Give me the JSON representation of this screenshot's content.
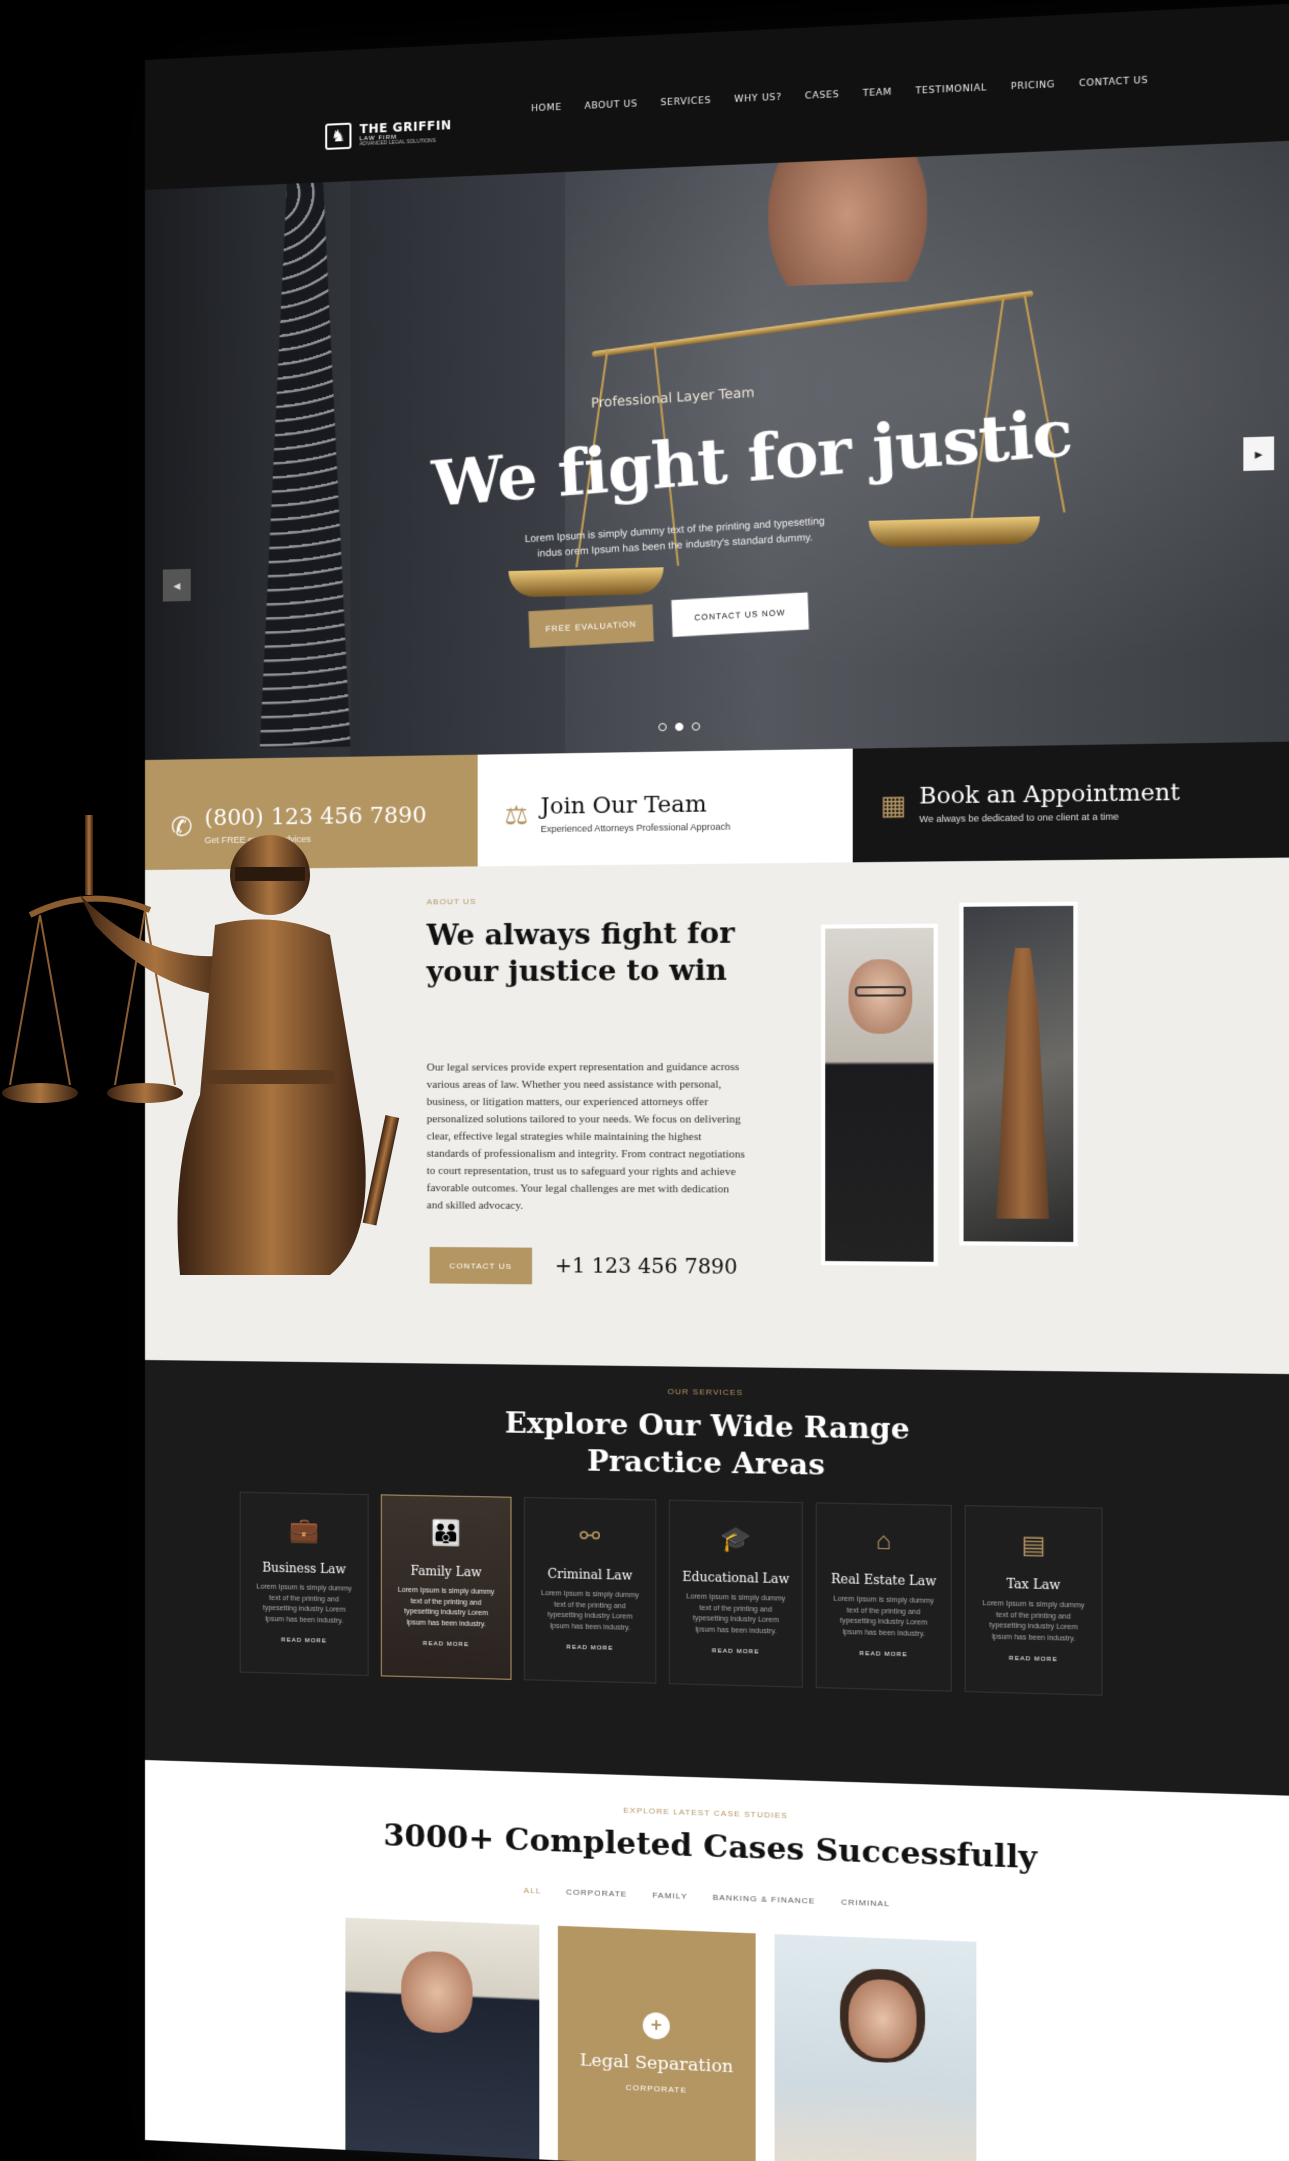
{
  "header": {
    "logo": {
      "name": "THE GRIFFIN",
      "sub": "LAW FIRM",
      "tag": "ADVANCED LEGAL SOLUTIONS"
    },
    "nav": [
      "HOME",
      "ABOUT US",
      "SERVICES",
      "WHY US?",
      "CASES",
      "TEAM",
      "TESTIMONIAL",
      "PRICING",
      "CONTACT US"
    ]
  },
  "hero": {
    "subtitle": "Professional Layer Team",
    "title": "We fight for justic",
    "text": "Lorem Ipsum is simply dummy text of the printing and typesetting indus orem Ipsum has been the industry's standard dummy.",
    "primary_button": "FREE EVALUATION",
    "secondary_button": "CONTACT US NOW",
    "prev_icon": "chevron-left-icon",
    "next_icon": "chevron-right-icon",
    "slide_count": 3,
    "active_slide": 1
  },
  "info_bar": {
    "phone": {
      "title": "(800) 123 456 7890",
      "sub": "Get FREE experts advices",
      "icon": "phone-icon"
    },
    "team": {
      "title": "Join Our Team",
      "sub": "Experienced Attorneys Professional Approach",
      "icon": "gavel-icon"
    },
    "appointment": {
      "title": "Book an Appointment",
      "sub": "We always be dedicated to one client at a time",
      "icon": "calendar-icon"
    }
  },
  "about": {
    "kicker": "ABOUT US",
    "title": "We always fight for your justice to win",
    "body": "Our legal services provide expert representation and guidance across various areas of law. Whether you need assistance with personal, business, or litigation matters, our experienced attorneys offer personalized solutions tailored to your needs. We focus on delivering clear, effective legal strategies while maintaining the highest standards of professionalism and integrity. From contract negotiations to court representation, trust us to safeguard your rights and achieve favorable outcomes. Your legal challenges are met with dedication and skilled advocacy.",
    "button": "CONTACT US",
    "phone": "+1 123 456 7890"
  },
  "services": {
    "kicker": "OUR SERVICES",
    "title_line1": "Explore Our Wide Range",
    "title_line2": "Practice Areas",
    "items": [
      {
        "name": "Business Law",
        "icon": "briefcase-icon",
        "desc": "Lorem Ipsum is simply dummy text of the printing and typesetting industry Lorem Ipsum has been industry.",
        "read": "READ MORE"
      },
      {
        "name": "Family Law",
        "icon": "family-icon",
        "desc": "Lorem Ipsum is simply dummy text of the printing and typesetting industry Lorem Ipsum has been industry.",
        "read": "READ MORE"
      },
      {
        "name": "Criminal Law",
        "icon": "handcuffs-icon",
        "desc": "Lorem Ipsum is simply dummy text of the printing and typesetting industry Lorem Ipsum has been industry.",
        "read": "READ MORE"
      },
      {
        "name": "Educational Law",
        "icon": "graduation-cap-icon",
        "desc": "Lorem Ipsum is simply dummy text of the printing and typesetting industry Lorem Ipsum has been industry.",
        "read": "READ MORE"
      },
      {
        "name": "Real Estate Law",
        "icon": "house-icon",
        "desc": "Lorem Ipsum is simply dummy text of the printing and typesetting industry Lorem Ipsum has been industry.",
        "read": "READ MORE"
      },
      {
        "name": "Tax Law",
        "icon": "tax-document-icon",
        "desc": "Lorem Ipsum is simply dummy text of the printing and typesetting industry Lorem Ipsum has been industry.",
        "read": "READ MORE"
      }
    ],
    "active_index": 1
  },
  "cases": {
    "kicker": "EXPLORE LATEST CASE STUDIES",
    "title": "3000+ Completed Cases Successfully",
    "filters": [
      "ALL",
      "CORPORATE",
      "FAMILY",
      "BANKING & FINANCE",
      "CRIMINAL"
    ],
    "active_filter": 0,
    "featured": {
      "name": "Legal Separation",
      "category": "CORPORATE"
    }
  },
  "colors": {
    "accent": "#b49663",
    "dark": "#151515",
    "light": "#efeeea"
  }
}
